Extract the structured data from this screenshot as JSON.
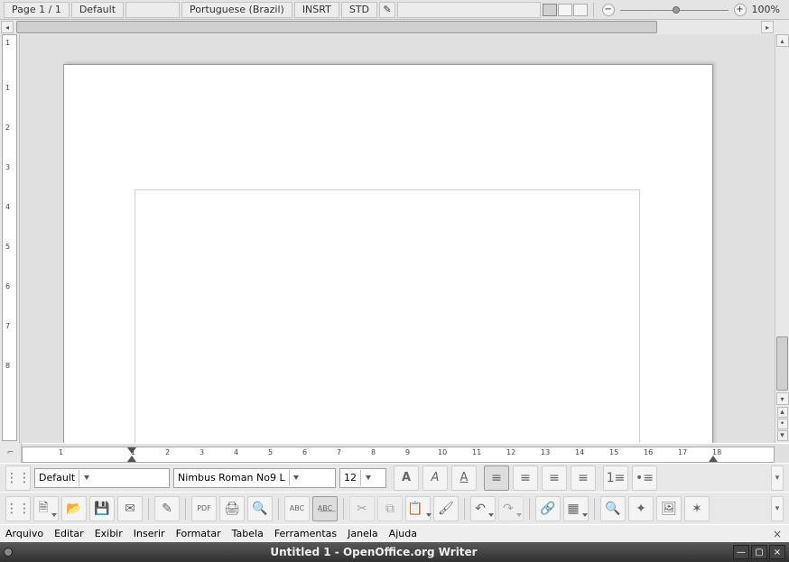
{
  "window": {
    "title": "Untitled 1 - OpenOffice.org Writer"
  },
  "menu": {
    "items": [
      "Arquivo",
      "Editar",
      "Exibir",
      "Inserir",
      "Formatar",
      "Tabela",
      "Ferramentas",
      "Janela",
      "Ajuda"
    ]
  },
  "main_toolbar": {
    "icons": [
      "new-doc",
      "open",
      "save",
      "mail",
      "",
      "edit-doc",
      "pdf",
      "print",
      "print-preview",
      "",
      "spellcheck",
      "auto-spellcheck",
      "",
      "cut",
      "copy",
      "paste",
      "format-paintbrush",
      "",
      "undo",
      "redo",
      "",
      "hyperlink",
      "table",
      "",
      "find",
      "navigator",
      "gallery",
      "data-sources",
      "zoom-help"
    ]
  },
  "format_toolbar": {
    "para_style": "Default",
    "font_name": "Nimbus Roman No9 L",
    "font_size": "12"
  },
  "ruler": {
    "numbers": [
      "1",
      "1",
      "2",
      "3",
      "4",
      "5",
      "6",
      "7",
      "8",
      "9",
      "10",
      "11",
      "12",
      "13",
      "14",
      "15",
      "16",
      "17",
      "18"
    ]
  },
  "vruler": {
    "numbers": [
      "1",
      "1",
      "2",
      "3",
      "4",
      "5",
      "6",
      "7",
      "8"
    ]
  },
  "status": {
    "page": "Page 1 / 1",
    "style": "Default",
    "lang": "Portuguese (Brazil)",
    "insert": "INSRT",
    "sel": "STD",
    "zoom": "100%"
  }
}
